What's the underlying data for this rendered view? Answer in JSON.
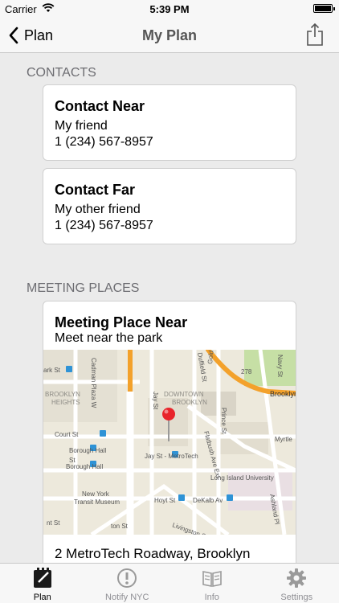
{
  "status_bar": {
    "carrier": "Carrier",
    "time": "5:39 PM"
  },
  "nav": {
    "back_label": "Plan",
    "title": "My Plan"
  },
  "contacts": {
    "header": "CONTACTS",
    "items": [
      {
        "name": "Contact Near",
        "person": "My friend",
        "phone": "1 (234) 567-8957"
      },
      {
        "name": "Contact Far",
        "person": "My other friend",
        "phone": "1 (234) 567-8957"
      }
    ]
  },
  "meeting_places": {
    "header": "MEETING PLACES",
    "place": {
      "name": "Meeting Place Near",
      "description": "Meet near the park",
      "address": "2 MetroTech Roadway, Brooklyn",
      "map_labels": {
        "l1": "ark St",
        "l2": "Cadman Plaza W",
        "l3": "Jay St",
        "l4": "Duffield St",
        "l5": "Gold St",
        "l6": "Navy St",
        "l7": "278",
        "l8": "Brooklyn Q",
        "l9": "BROOKLYN",
        "l10": "HEIGHTS",
        "l11": "DOWNTOWN",
        "l12": "BROOKLYN",
        "l13": "Court St",
        "l14": "Borough Hall",
        "l15": "Borough Hall",
        "l16": "Jay St - MetroTech",
        "l17": "Flatbush Ave Ext",
        "l18": "Prince St",
        "l19": "Myrtle",
        "l20": "Long Island University",
        "l21": "New York",
        "l22": "Transit Museum",
        "l23": "Hoyt St",
        "l24": "DeKalb Av",
        "l25": "Ashland Pl",
        "l26": "Livingston St",
        "l27": "St",
        "l28": "nt St",
        "l29": "ton St"
      }
    }
  },
  "tabs": [
    {
      "label": "Plan",
      "icon": "notepad-icon",
      "active": true
    },
    {
      "label": "Notify NYC",
      "icon": "alert-icon",
      "active": false
    },
    {
      "label": "Info",
      "icon": "book-icon",
      "active": false
    },
    {
      "label": "Settings",
      "icon": "gear-icon",
      "active": false
    }
  ],
  "colors": {
    "pin": "#e8242b",
    "highway": "#f3a12b",
    "subway": "#2f93d6",
    "park": "#c6dfa5"
  }
}
